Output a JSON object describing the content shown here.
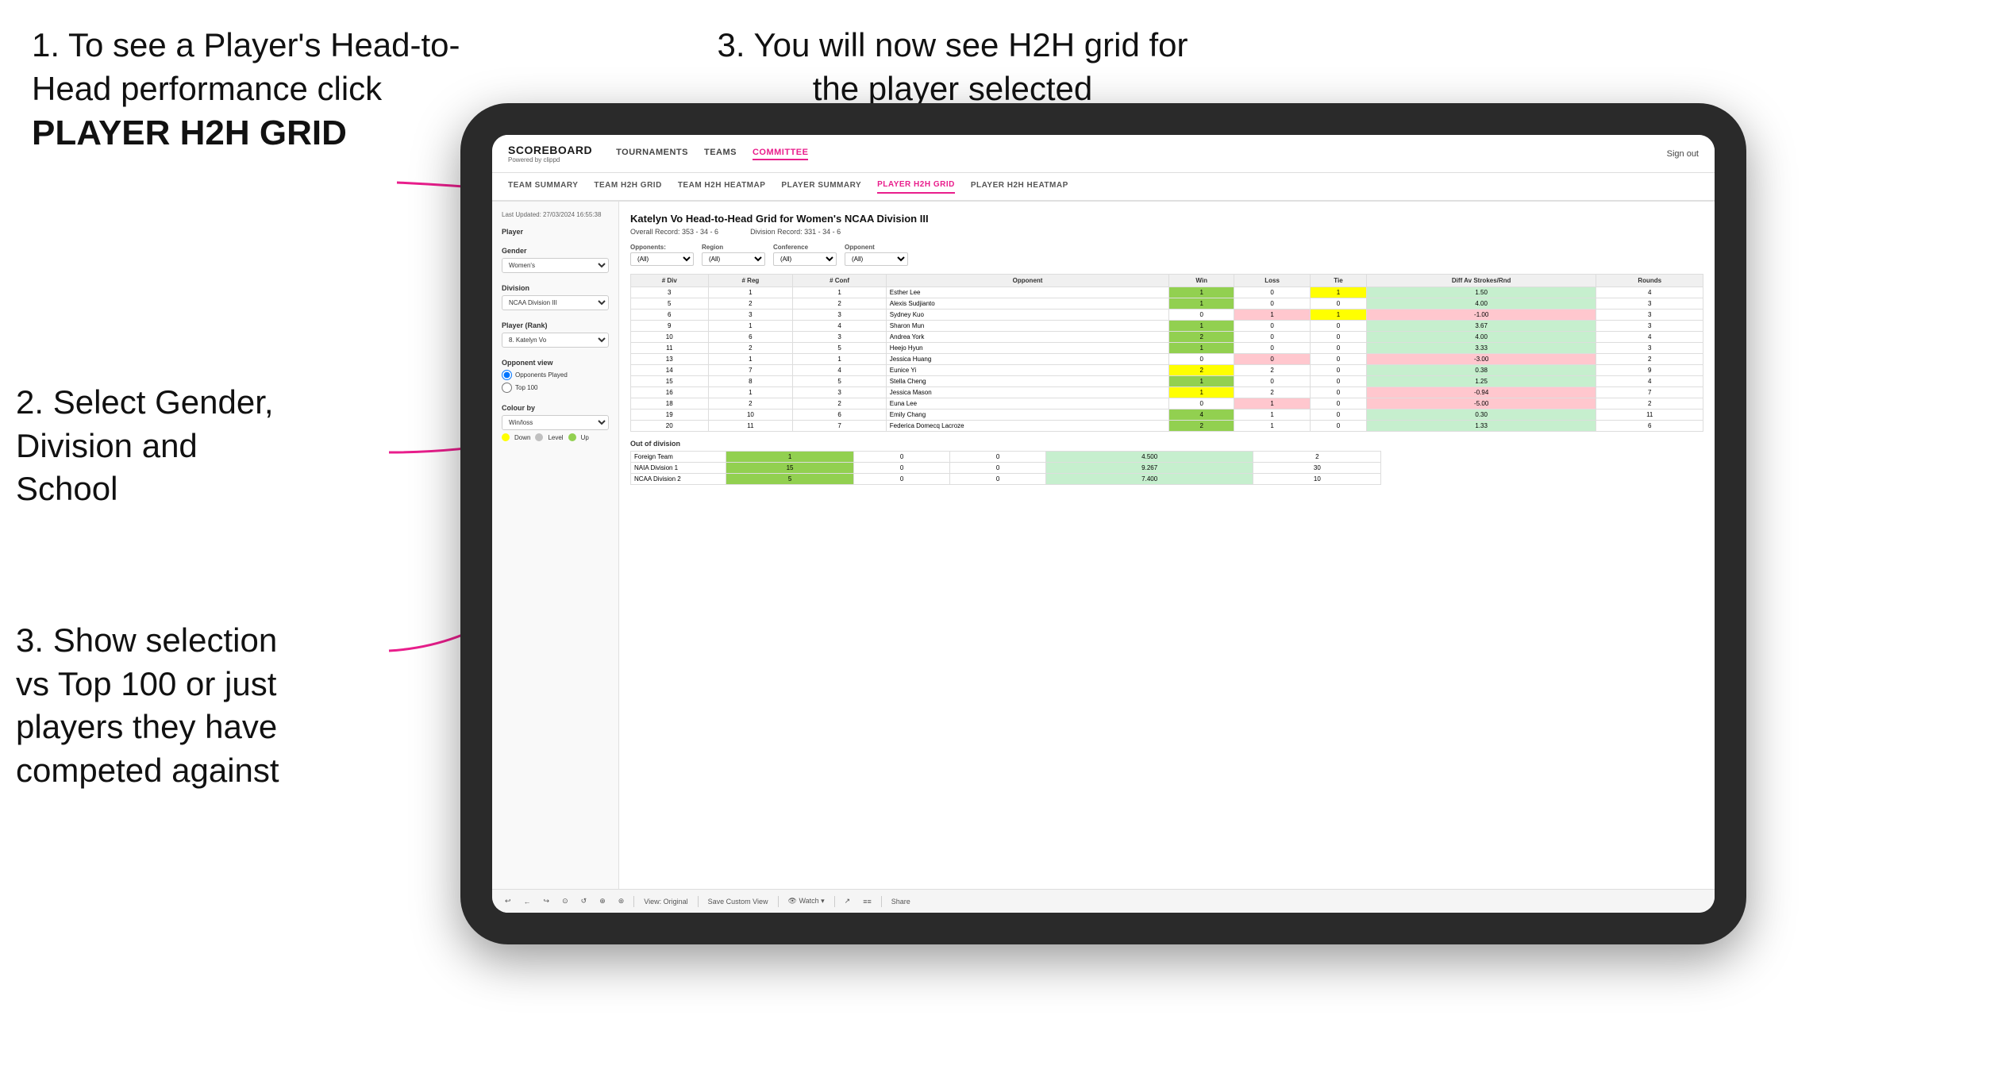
{
  "instructions": {
    "step1": {
      "text": "1. To see a Player's Head-to-Head performance click",
      "bold": "PLAYER H2H GRID"
    },
    "step2": {
      "text": "2. Select Gender, Division and School"
    },
    "step3_top": {
      "text": "3. You will now see H2H grid for the player selected"
    },
    "step3_bottom": {
      "text": "3. Show selection vs Top 100 or just players they have competed against"
    }
  },
  "nav": {
    "logo": "SCOREBOARD",
    "logo_sub": "Powered by clippd",
    "links": [
      "TOURNAMENTS",
      "TEAMS",
      "COMMITTEE"
    ],
    "active_link": "COMMITTEE",
    "sign_out": "Sign out"
  },
  "secondary_nav": {
    "links": [
      "TEAM SUMMARY",
      "TEAM H2H GRID",
      "TEAM H2H HEATMAP",
      "PLAYER SUMMARY",
      "PLAYER H2H GRID",
      "PLAYER H2H HEATMAP"
    ],
    "active": "PLAYER H2H GRID"
  },
  "sidebar": {
    "timestamp": "Last Updated: 27/03/2024 16:55:38",
    "player_label": "Player",
    "gender_label": "Gender",
    "gender_value": "Women's",
    "division_label": "Division",
    "division_value": "NCAA Division III",
    "player_rank_label": "Player (Rank)",
    "player_rank_value": "8. Katelyn Vo",
    "opponent_view_label": "Opponent view",
    "opponent_options": [
      "Opponents Played",
      "Top 100"
    ],
    "opponent_selected": "Opponents Played",
    "colour_label": "Colour by",
    "colour_value": "Win/loss",
    "colour_options": [
      "Down",
      "Level",
      "Up"
    ]
  },
  "grid": {
    "title": "Katelyn Vo Head-to-Head Grid for Women's NCAA Division III",
    "overall_record": "Overall Record: 353 - 34 - 6",
    "division_record": "Division Record: 331 - 34 - 6",
    "filter_labels": [
      "Opponents:",
      "Region",
      "Conference",
      "Opponent"
    ],
    "filter_values": [
      "(All)",
      "(All)",
      "(All)",
      "(All)"
    ],
    "col_headers": [
      "# Div",
      "# Reg",
      "# Conf",
      "Opponent",
      "Win",
      "Loss",
      "Tie",
      "Diff Av Strokes/Rnd",
      "Rounds"
    ],
    "rows": [
      {
        "div": "3",
        "reg": "1",
        "conf": "1",
        "opponent": "Esther Lee",
        "win": "1",
        "loss": "0",
        "tie": "1",
        "diff": "1.50",
        "rounds": "4",
        "win_class": "green",
        "loss_class": "",
        "tie_class": "yellow"
      },
      {
        "div": "5",
        "reg": "2",
        "conf": "2",
        "opponent": "Alexis Sudjianto",
        "win": "1",
        "loss": "0",
        "tie": "0",
        "diff": "4.00",
        "rounds": "3",
        "win_class": "green",
        "loss_class": "",
        "tie_class": ""
      },
      {
        "div": "6",
        "reg": "3",
        "conf": "3",
        "opponent": "Sydney Kuo",
        "win": "0",
        "loss": "1",
        "tie": "1",
        "diff": "-1.00",
        "rounds": "3",
        "win_class": "",
        "loss_class": "red",
        "tie_class": "yellow"
      },
      {
        "div": "9",
        "reg": "1",
        "conf": "4",
        "opponent": "Sharon Mun",
        "win": "1",
        "loss": "0",
        "tie": "0",
        "diff": "3.67",
        "rounds": "3",
        "win_class": "green",
        "loss_class": "",
        "tie_class": ""
      },
      {
        "div": "10",
        "reg": "6",
        "conf": "3",
        "opponent": "Andrea York",
        "win": "2",
        "loss": "0",
        "tie": "0",
        "diff": "4.00",
        "rounds": "4",
        "win_class": "green",
        "loss_class": "",
        "tie_class": ""
      },
      {
        "div": "11",
        "reg": "2",
        "conf": "5",
        "opponent": "Heejo Hyun",
        "win": "1",
        "loss": "0",
        "tie": "0",
        "diff": "3.33",
        "rounds": "3",
        "win_class": "green",
        "loss_class": "",
        "tie_class": ""
      },
      {
        "div": "13",
        "reg": "1",
        "conf": "1",
        "opponent": "Jessica Huang",
        "win": "0",
        "loss": "0",
        "tie": "0",
        "diff": "-3.00",
        "rounds": "2",
        "win_class": "",
        "loss_class": "red",
        "tie_class": ""
      },
      {
        "div": "14",
        "reg": "7",
        "conf": "4",
        "opponent": "Eunice Yi",
        "win": "2",
        "loss": "2",
        "tie": "0",
        "diff": "0.38",
        "rounds": "9",
        "win_class": "yellow",
        "loss_class": "",
        "tie_class": ""
      },
      {
        "div": "15",
        "reg": "8",
        "conf": "5",
        "opponent": "Stella Cheng",
        "win": "1",
        "loss": "0",
        "tie": "0",
        "diff": "1.25",
        "rounds": "4",
        "win_class": "green",
        "loss_class": "",
        "tie_class": ""
      },
      {
        "div": "16",
        "reg": "1",
        "conf": "3",
        "opponent": "Jessica Mason",
        "win": "1",
        "loss": "2",
        "tie": "0",
        "diff": "-0.94",
        "rounds": "7",
        "win_class": "yellow",
        "loss_class": "",
        "tie_class": ""
      },
      {
        "div": "18",
        "reg": "2",
        "conf": "2",
        "opponent": "Euna Lee",
        "win": "0",
        "loss": "1",
        "tie": "0",
        "diff": "-5.00",
        "rounds": "2",
        "win_class": "",
        "loss_class": "red",
        "tie_class": ""
      },
      {
        "div": "19",
        "reg": "10",
        "conf": "6",
        "opponent": "Emily Chang",
        "win": "4",
        "loss": "1",
        "tie": "0",
        "diff": "0.30",
        "rounds": "11",
        "win_class": "green",
        "loss_class": "",
        "tie_class": ""
      },
      {
        "div": "20",
        "reg": "11",
        "conf": "7",
        "opponent": "Federica Domecq Lacroze",
        "win": "2",
        "loss": "1",
        "tie": "0",
        "diff": "1.33",
        "rounds": "6",
        "win_class": "green",
        "loss_class": "",
        "tie_class": ""
      }
    ],
    "out_of_division_label": "Out of division",
    "out_of_division_rows": [
      {
        "label": "Foreign Team",
        "win": "1",
        "loss": "0",
        "tie": "0",
        "diff": "4.500",
        "rounds": "2"
      },
      {
        "label": "NAIA Division 1",
        "win": "15",
        "loss": "0",
        "tie": "0",
        "diff": "9.267",
        "rounds": "30"
      },
      {
        "label": "NCAA Division 2",
        "win": "5",
        "loss": "0",
        "tie": "0",
        "diff": "7.400",
        "rounds": "10"
      }
    ]
  },
  "toolbar": {
    "buttons": [
      "↩",
      "←",
      "↪",
      "⊙",
      "↺",
      "⊕",
      "⊛",
      "View: Original",
      "Save Custom View",
      "Watch ▾",
      "↗",
      "≡≡",
      "Share"
    ]
  },
  "colours": {
    "down": "#ffff00",
    "level": "#c0c0c0",
    "up": "#92d050"
  }
}
